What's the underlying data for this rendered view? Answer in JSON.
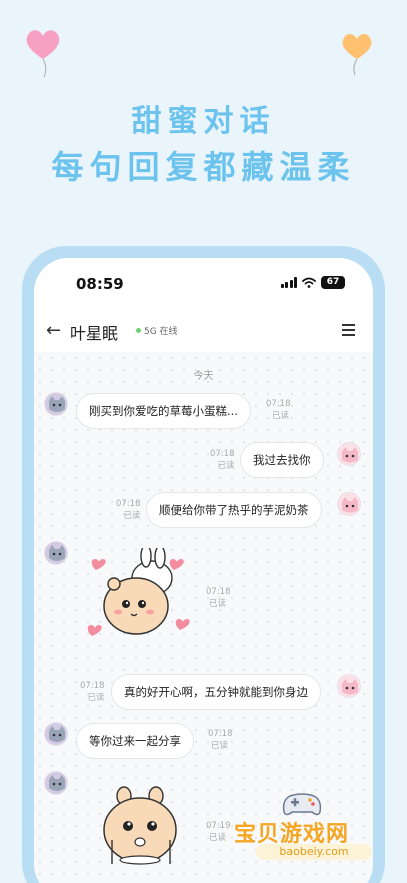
{
  "hero": {
    "line1": "甜蜜对话",
    "line2": "每句回复都藏温柔"
  },
  "status_bar": {
    "time": "08:59",
    "battery": "67"
  },
  "chat_header": {
    "name": "叶星眠",
    "presence": "5G 在线"
  },
  "chat": {
    "date_separator": "今天",
    "messages": [
      {
        "side": "left",
        "text": "刚买到你爱吃的草莓小蛋糕...",
        "time": "07:18",
        "status": "已读"
      },
      {
        "side": "right",
        "text": "我过去找你",
        "time": "07:18",
        "status": "已读"
      },
      {
        "side": "right",
        "text": "顺便给你带了热乎的芋泥奶茶",
        "time": "07:18",
        "status": "已读"
      },
      {
        "side": "left",
        "sticker": "bunny-hug-sticker",
        "time": "07:18",
        "status": "已读"
      },
      {
        "side": "right",
        "text": "真的好开心啊，五分钟就能到你身边",
        "time": "07:18",
        "status": "已读"
      },
      {
        "side": "left",
        "text": "等你过来一起分享",
        "time": "07:18",
        "status": "已读"
      },
      {
        "side": "left",
        "sticker": "bunny-eating-sticker",
        "time": "07:19",
        "status": "已读"
      }
    ]
  },
  "watermark": {
    "title": "宝贝游戏网",
    "url": "baobeiy.com"
  },
  "colors": {
    "background": "#e9f4fb",
    "hero_text": "#6cc3ee",
    "frame": "#b9ddf3",
    "online_dot": "#6ed26e"
  },
  "icons": [
    "heart-balloon-pink-icon",
    "heart-balloon-orange-icon",
    "back-arrow-icon",
    "menu-icon",
    "signal-icon",
    "wifi-icon",
    "battery-icon",
    "gamepad-icon"
  ]
}
